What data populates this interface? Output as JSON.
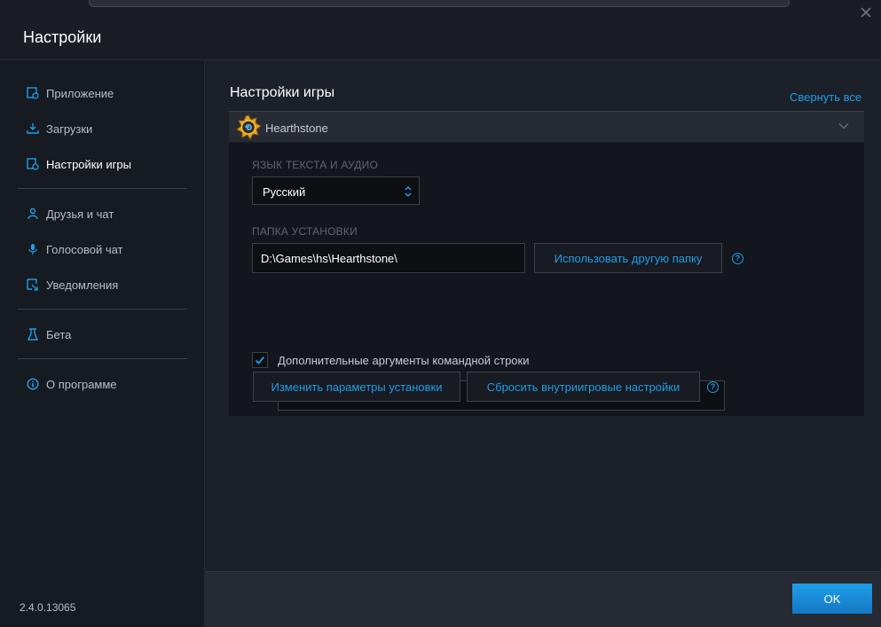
{
  "window": {
    "title": "Настройки"
  },
  "sidebar": {
    "items": [
      {
        "label": "Приложение",
        "icon": "app-settings-icon",
        "active": false
      },
      {
        "label": "Загрузки",
        "icon": "download-icon",
        "active": false
      },
      {
        "label": "Настройки игры",
        "icon": "game-settings-icon",
        "active": true
      },
      {
        "label": "Друзья и чат",
        "icon": "friends-icon",
        "active": false
      },
      {
        "label": "Голосовой чат",
        "icon": "microphone-icon",
        "active": false
      },
      {
        "label": "Уведомления",
        "icon": "notification-icon",
        "active": false
      },
      {
        "label": "Бета",
        "icon": "beta-flask-icon",
        "active": false
      },
      {
        "label": "О программе",
        "icon": "info-icon",
        "active": false
      }
    ],
    "version": "2.4.0.13065"
  },
  "main": {
    "section_title": "Настройки игры",
    "collapse_all_label": "Свернуть все",
    "game": {
      "name": "Hearthstone",
      "logo_icon": "hearthstone-logo-icon",
      "language_label": "ЯЗЫК ТЕКСТА И АУДИО",
      "language_value": "Русский",
      "install_folder_label": "ПАПКА УСТАНОВКИ",
      "install_path": "D:\\Games\\hs\\Hearthstone\\",
      "use_other_folder_label": "Использовать другую папку",
      "cmd_args_label": "Дополнительные аргументы командной строки",
      "cmd_args_checked": true,
      "cmd_args_value": "",
      "change_install_label": "Изменить параметры установки",
      "reset_ingame_label": "Сбросить внутриигровые настройки"
    }
  },
  "footer": {
    "ok_label": "OK"
  },
  "colors": {
    "accent": "#1e9ee8",
    "background": "#1c2028",
    "sidebar": "#161a21",
    "panel": "#13161c"
  }
}
